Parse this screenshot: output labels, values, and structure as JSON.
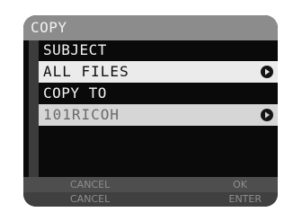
{
  "header": {
    "title": "COPY"
  },
  "subject": {
    "label": "SUBJECT",
    "value": "ALL FILES",
    "arrow_icon": "right-arrow-circle-icon"
  },
  "copy_to": {
    "label": "COPY TO",
    "value": "101RICOH",
    "arrow_icon": "right-arrow-circle-icon"
  },
  "softkeys": {
    "row1": {
      "left": "CANCEL",
      "right": "OK"
    },
    "row2": {
      "left": "CANCEL",
      "right": "ENTER"
    }
  },
  "colors": {
    "title_bar": "#8c8c8c",
    "selected_row": "#ebebeb",
    "unselected_row": "#d6d6d6",
    "screen_background": "#0a0a0a"
  }
}
